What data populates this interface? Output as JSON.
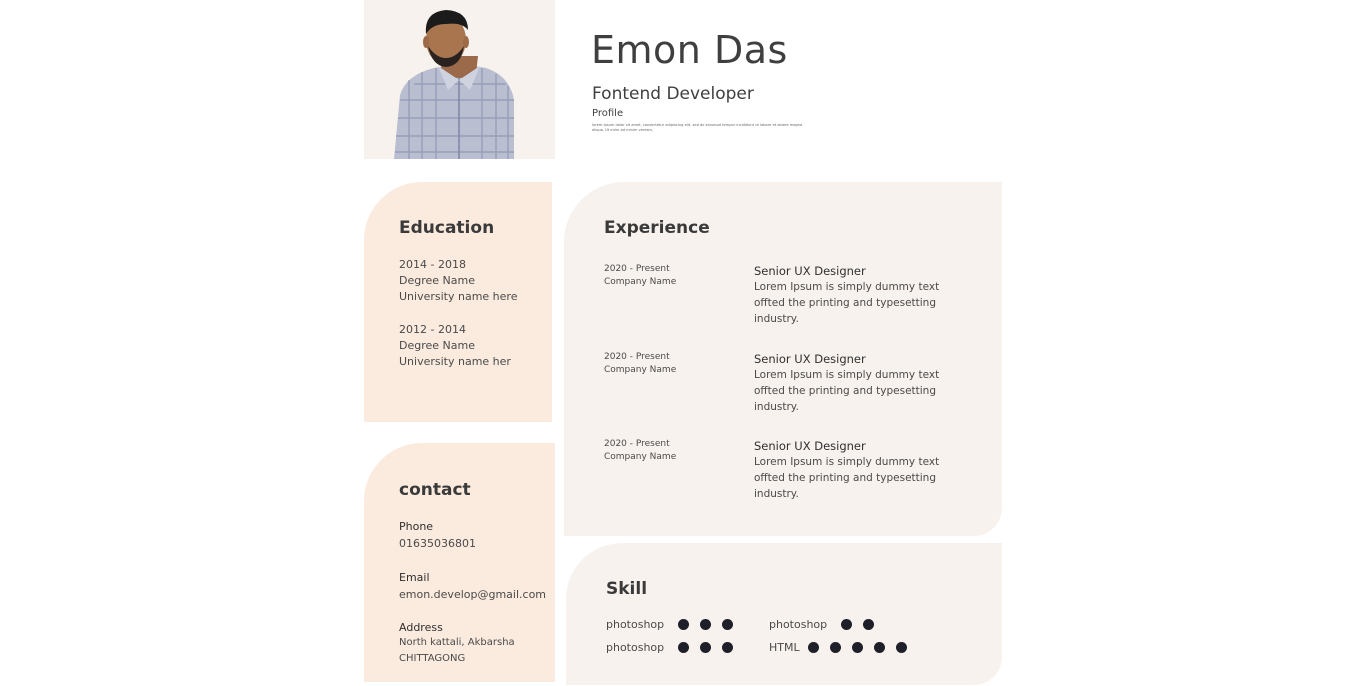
{
  "header": {
    "name": "Emon Das",
    "role": "Fontend Developer",
    "profile_label": "Profile",
    "profile_text": "lorem ipsum dolor sit amet, consectetur adipiscing elit, sed do eiusmod tempor incididunt ut labore et dolore magna aliqua. Ut enim ad minim veniam,"
  },
  "education": {
    "title": "Education",
    "entries": [
      {
        "years": "2014 - 2018",
        "degree": "Degree Name",
        "university": "University name here"
      },
      {
        "years": "2012 - 2014",
        "degree": "Degree Name",
        "university": "University name her"
      }
    ]
  },
  "contact": {
    "title": "contact",
    "phone_label": "Phone",
    "phone": "01635036801",
    "email_label": "Email",
    "email": "emon.develop@gmail.com",
    "address_label": "Address",
    "address_line1": "North kattali, Akbarsha",
    "address_line2": "CHITTAGONG"
  },
  "experience": {
    "title": "Experience",
    "jobs": [
      {
        "period": "2020 - Present",
        "company": "Company Name",
        "title": "Senior UX Designer",
        "desc": "Lorem Ipsum is simply dummy text offted the printing and typesetting industry."
      },
      {
        "period": "2020 - Present",
        "company": "Company Name",
        "title": "Senior UX Designer",
        "desc": "Lorem Ipsum is simply dummy text offted the printing and typesetting industry."
      },
      {
        "period": "2020 - Present",
        "company": "Company Name",
        "title": "Senior UX Designer",
        "desc": "Lorem Ipsum is simply dummy text offted the printing and typesetting industry."
      }
    ]
  },
  "skills": {
    "title": "Skill",
    "items": [
      {
        "name": "photoshop",
        "level": 3
      },
      {
        "name": "photoshop",
        "level": 2
      },
      {
        "name": "photoshop",
        "level": 3
      },
      {
        "name": "HTML",
        "level": 5
      }
    ]
  },
  "colors": {
    "card_peach": "#fbebdf",
    "card_light": "#f8f2ee",
    "dot": "#1f1f2a"
  }
}
